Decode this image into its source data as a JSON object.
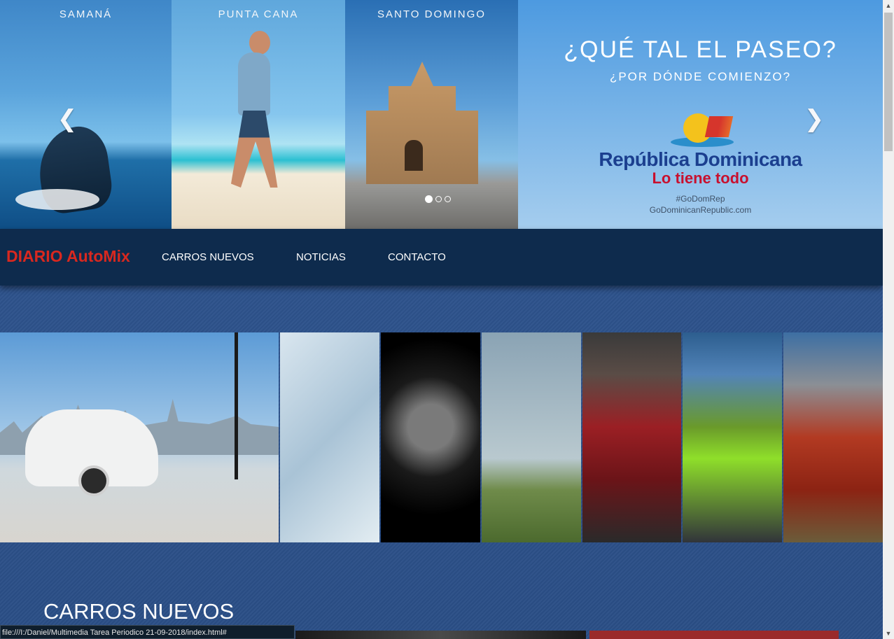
{
  "hero": {
    "panels": [
      {
        "label": "SAMANÁ"
      },
      {
        "label": "PUNTA CANA"
      },
      {
        "label": "SANTO DOMINGO"
      }
    ],
    "headline": "¿QUÉ TAL EL PASEO?",
    "subline": "¿POR DÓNDE COMIENZO?",
    "brand_name": "República Dominicana",
    "brand_tagline": "Lo tiene todo",
    "hashtag": "#GoDomRep",
    "website": "GoDominicanRepublic.com",
    "prev_icon": "chevron-left-icon",
    "next_icon": "chevron-right-icon",
    "prev_glyph": "❮",
    "next_glyph": "❯",
    "slide_count": 3,
    "active_slide": 1
  },
  "navbar": {
    "brand": "DIARIO AutoMix",
    "links": [
      "CARROS NUEVOS",
      "NOTICIAS",
      "CONTACTO"
    ]
  },
  "section": {
    "title": "CARROS NUEVOS"
  },
  "status_bar": {
    "url": "file:///I:/Daniel/Multimedia Tarea Periodico 21-09-2018/index.html#"
  },
  "scrollbar": {
    "up_glyph": "▲",
    "down_glyph": "▼"
  },
  "colors": {
    "navbar": "#0e2b4d",
    "brand_red": "#d9281f",
    "page_blue": "#2d5288"
  }
}
